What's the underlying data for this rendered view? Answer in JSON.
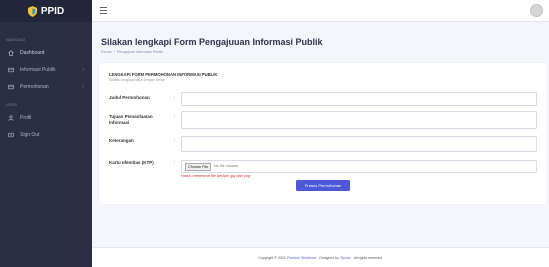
{
  "app": {
    "logo_text": "PPID"
  },
  "sidebar": {
    "heading_main": "NAVIGASI",
    "heading_user": "USER",
    "items": [
      {
        "label": "Dashboard",
        "icon": "home-icon"
      },
      {
        "label": "Informasi Publik",
        "icon": "table-icon",
        "chevron": "›"
      },
      {
        "label": "Permohonan",
        "icon": "table-icon",
        "chevron": "›"
      },
      {
        "label": "Profil",
        "icon": "user-icon"
      },
      {
        "label": "Sign Out",
        "icon": "signout-icon"
      }
    ]
  },
  "header": {
    "title": "Silakan lengkapi Form Pengajuuan Informasi Publik",
    "breadcrumb": [
      "Forms",
      "Pengajuan Informasi Publik"
    ],
    "breadcrumb_sep": "/"
  },
  "form": {
    "title": "LENGKAPI FORM PERMOHONAN INFORMASI PUBLIK",
    "subtitle": "Silakan lengkapi data dengan benar",
    "colon": ":",
    "fields": {
      "judul": {
        "label": "Judul Permohonan",
        "value": ""
      },
      "tujuan": {
        "label": "Tujuan Pemanfaatan Informasi",
        "value": ""
      },
      "keterangan": {
        "label": "Keterangan",
        "value": ""
      },
      "ktp": {
        "label": "Kartu Identitas (KTP)",
        "button": "Choose File",
        "status": "No file chosen",
        "hint": "Harus menerima file berbpe jpg dan png"
      }
    },
    "submit_label": "Proses Permohonan"
  },
  "footer": {
    "prefix": "Copyright © 2024",
    "link1": "Pembuk Struktural",
    "middle": ". Designed by",
    "link2": "Sprutu",
    "suffix": "All rights reserved."
  },
  "colors": {
    "sidebar_bg": "#2a2f45",
    "accent": "#4e58d6",
    "error": "#d9312e"
  }
}
